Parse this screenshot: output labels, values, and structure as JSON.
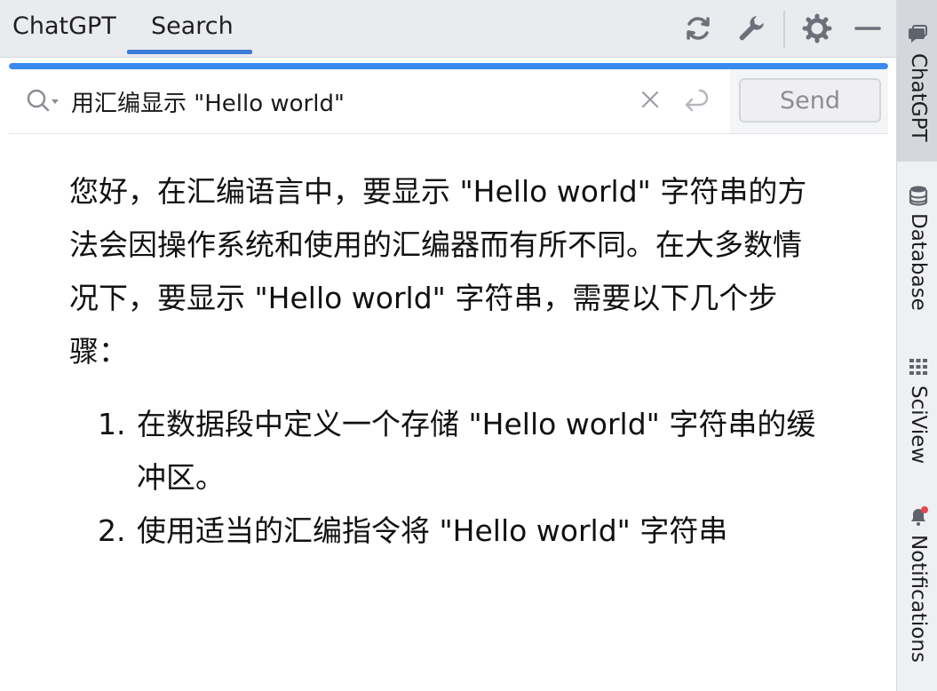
{
  "tabs": [
    {
      "label": "ChatGPT",
      "active": false
    },
    {
      "label": "Search",
      "active": true
    }
  ],
  "toolbar_icons": [
    "refresh-icon",
    "wrench-icon",
    "gear-icon",
    "minimize-icon"
  ],
  "progress": {
    "fraction": 1.0,
    "color": "#3a8af0"
  },
  "search": {
    "value": "用汇编显示 \"Hello world\"",
    "send_label": "Send"
  },
  "answer": {
    "paragraph": "您好，在汇编语言中，要显示 \"Hello world\" 字符串的方法会因操作系统和使用的汇编器而有所不同。在大多数情况下，要显示 \"Hello world\" 字符串，需要以下几个步骤：",
    "steps": [
      "在数据段中定义一个存储 \"Hello world\" 字符串的缓冲区。",
      "使用适当的汇编指令将 \"Hello world\" 字符串"
    ]
  },
  "side_panel": [
    {
      "label": "ChatGPT",
      "icon": "chat-icon",
      "active": true
    },
    {
      "label": "Database",
      "icon": "database-icon",
      "active": false
    },
    {
      "label": "SciView",
      "icon": "grid-icon",
      "active": false
    },
    {
      "label": "Notifications",
      "icon": "bell-icon",
      "active": false,
      "has_badge": true
    }
  ],
  "colors": {
    "accent": "#3d7bd9",
    "badge": "#e5484d"
  }
}
